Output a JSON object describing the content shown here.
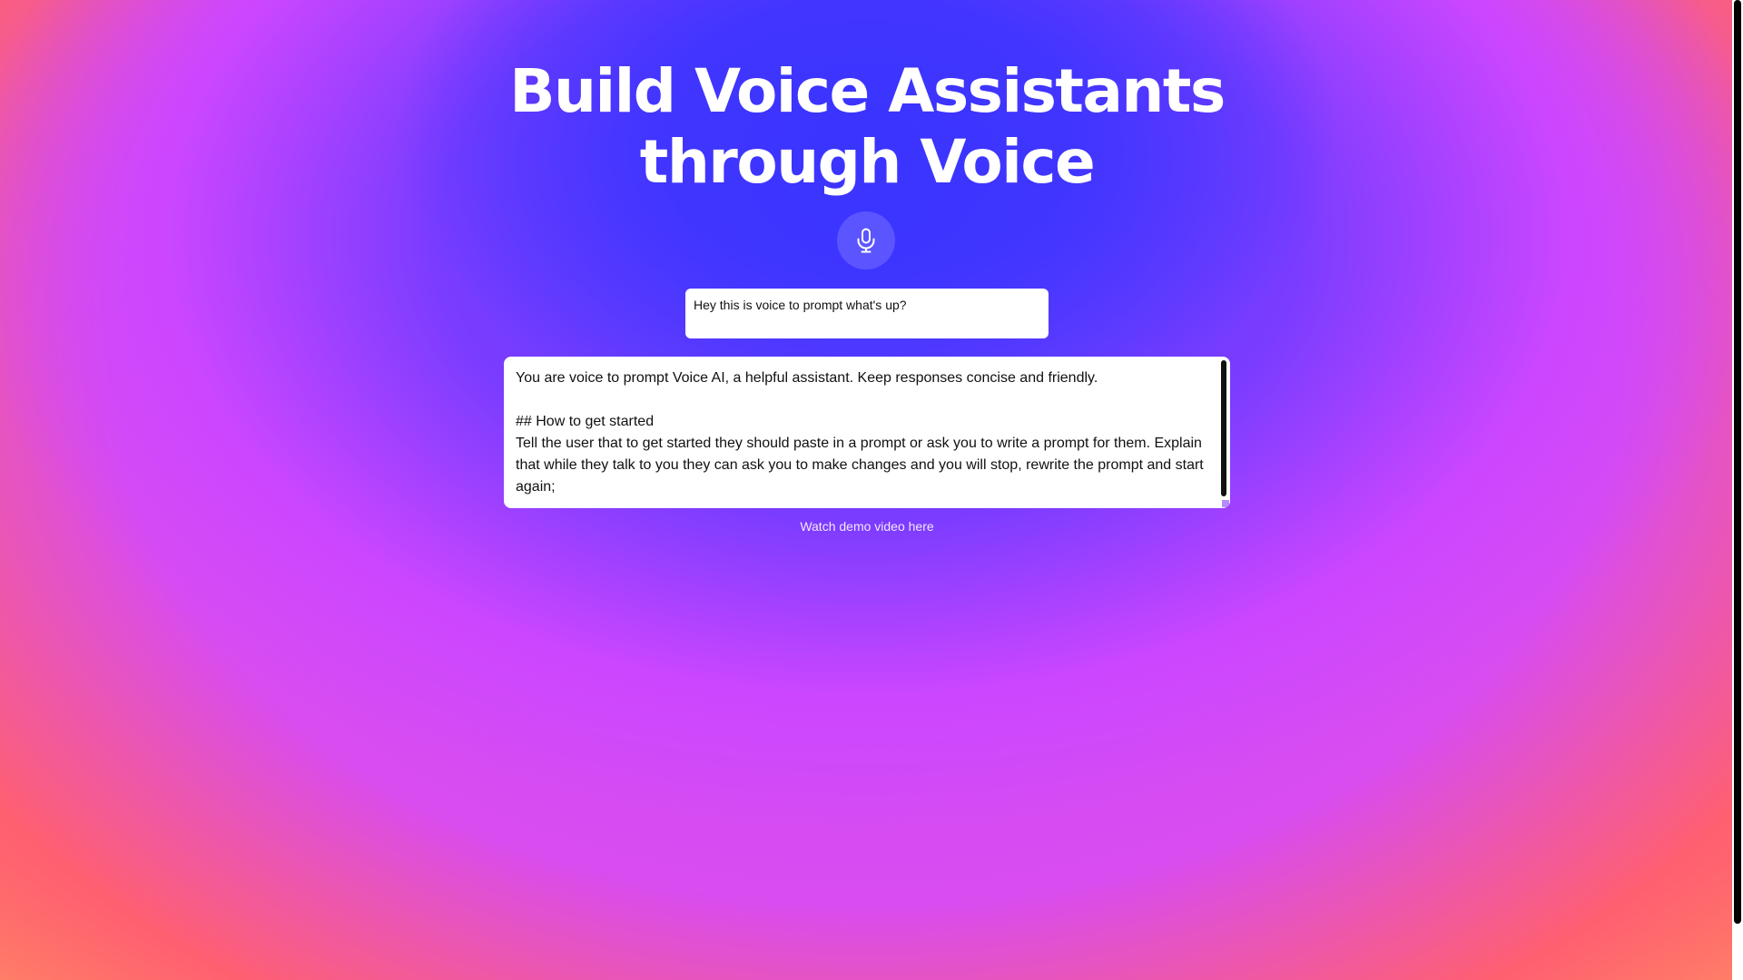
{
  "hero": {
    "title": "Build Voice Assistants through Voice"
  },
  "mic": {
    "icon": "microphone-icon"
  },
  "transcript": {
    "text": "Hey this is voice to prompt what's up?"
  },
  "prompt": {
    "lines": [
      "You are voice to prompt Voice AI, a helpful assistant. Keep responses concise and friendly.",
      "",
      "## How to get started",
      "Tell the user that to get started they should paste in a prompt or ask you to write a prompt for them. Explain that while they talk to you they can ask you to make changes and you will stop, rewrite the prompt and start again;"
    ]
  },
  "demo": {
    "link_text": "Watch demo video here"
  },
  "colors": {
    "top_glow": "#3a34ff",
    "mid": "#cc46ff",
    "bottom": "#ff6a6a"
  }
}
